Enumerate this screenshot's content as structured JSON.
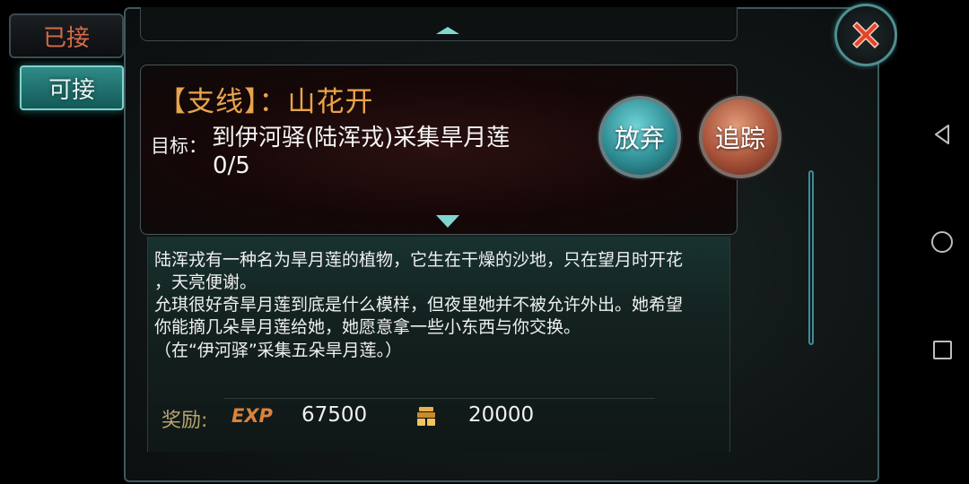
{
  "tabs": {
    "accepted": "已接",
    "available": "可接"
  },
  "quest": {
    "title": "【支线】：山花开",
    "target_label": "目标：",
    "target_text": "到伊河驿(陆浑戎)采集旱月莲",
    "progress": "0/5"
  },
  "buttons": {
    "abandon": "放弃",
    "track": "追踪"
  },
  "description": {
    "lines": [
      "陆浑戎有一种名为旱月莲的植物，它生在干燥的沙地，只在望月时开花",
      "，天亮便谢。",
      "允琪很好奇旱月莲到底是什么模样，但夜里她并不被允许外出。她希望",
      "你能摘几朵旱月莲给她，她愿意拿一些小东西与你交换。",
      "（在“伊河驿”采集五朵旱月莲。）"
    ]
  },
  "rewards": {
    "label": "奖励:",
    "exp_label": "EXP",
    "exp_value": "67500",
    "coin_icon": "coin-stack-icon",
    "coin_value": "20000"
  },
  "colors": {
    "title": "#e8a34c",
    "abandon_button": "#2f8e95",
    "track_button": "#a8523a",
    "close_x": "#e0452a"
  }
}
